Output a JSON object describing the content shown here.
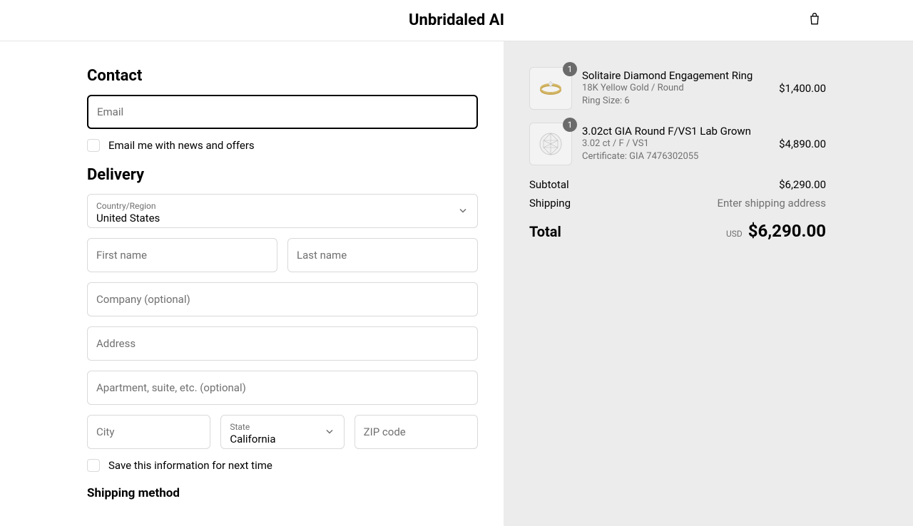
{
  "header": {
    "brand": "Unbridaled AI"
  },
  "contact": {
    "title": "Contact",
    "email_placeholder": "Email",
    "newsletter_label": "Email me with news and offers"
  },
  "delivery": {
    "title": "Delivery",
    "country_label": "Country/Region",
    "country_value": "United States",
    "first_name_placeholder": "First name",
    "last_name_placeholder": "Last name",
    "company_placeholder": "Company (optional)",
    "address_placeholder": "Address",
    "apartment_placeholder": "Apartment, suite, etc. (optional)",
    "city_placeholder": "City",
    "state_label": "State",
    "state_value": "California",
    "zip_placeholder": "ZIP code",
    "save_label": "Save this information for next time",
    "shipping_method_title": "Shipping method"
  },
  "cart": {
    "items": [
      {
        "qty": "1",
        "title": "Solitaire Diamond Engagement Ring",
        "meta1": "18K Yellow Gold / Round",
        "meta2": "Ring Size: 6",
        "price": "$1,400.00"
      },
      {
        "qty": "1",
        "title": "3.02ct GIA Round F/VS1 Lab Grown",
        "meta1": "3.02 ct / F / VS1",
        "meta2": "Certificate: GIA 7476302055",
        "price": "$4,890.00"
      }
    ],
    "subtotal_label": "Subtotal",
    "subtotal_value": "$6,290.00",
    "shipping_label": "Shipping",
    "shipping_value": "Enter shipping address",
    "total_label": "Total",
    "total_currency": "USD",
    "total_value": "$6,290.00"
  }
}
